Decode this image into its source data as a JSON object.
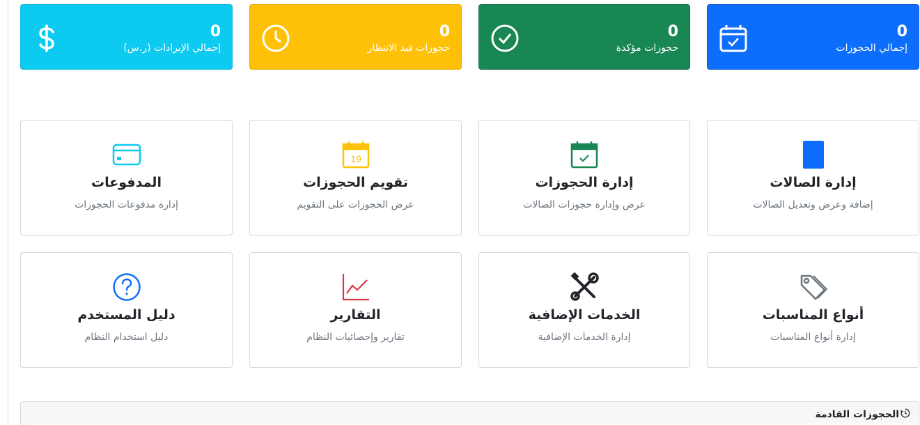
{
  "stats": [
    {
      "key": "total",
      "value": "0",
      "label": "إجمالي الحجوزات",
      "icon": "calendar-check-icon",
      "color": "#0d6efd"
    },
    {
      "key": "confirmed",
      "value": "0",
      "label": "حجوزات مؤكدة",
      "icon": "check-circle-icon",
      "color": "#198754"
    },
    {
      "key": "pending",
      "value": "0",
      "label": "حجوزات قيد الانتظار",
      "icon": "clock-icon",
      "color": "#ffc107"
    },
    {
      "key": "revenue",
      "value": "0",
      "label": "إجمالي الإيرادات (ر.س)",
      "icon": "dollar-icon",
      "color": "#0dcaf0"
    }
  ],
  "features": [
    {
      "key": "halls",
      "title": "إدارة الصالات",
      "description": "إضافة وعرض وتعديل الصالات",
      "icon": "door-icon",
      "color": "#0d6efd"
    },
    {
      "key": "bookings",
      "title": "إدارة الحجوزات",
      "description": "عرض وإدارة حجوزات الصالات",
      "icon": "calendar-check-icon",
      "color": "#198754"
    },
    {
      "key": "calendar",
      "title": "تقويم الحجوزات",
      "description": "عرض الحجوزات على التقويم",
      "icon": "calendar-date-icon",
      "icon_text": "19",
      "color": "#ffc107"
    },
    {
      "key": "payments",
      "title": "المدفوعات",
      "description": "إدارة مدفوعات الحجوزات",
      "icon": "credit-card-icon",
      "color": "#0dcaf0"
    },
    {
      "key": "occasions",
      "title": "أنواع المناسبات",
      "description": "إدارة أنواع المناسبات",
      "icon": "tag-icon",
      "color": "#6c757d"
    },
    {
      "key": "services",
      "title": "الخدمات الإضافية",
      "description": "إدارة الخدمات الإضافية",
      "icon": "tools-icon",
      "color": "#212529"
    },
    {
      "key": "reports",
      "title": "التقارير",
      "description": "تقارير وإحصائيات النظام",
      "icon": "line-chart-icon",
      "color": "#dc3545"
    },
    {
      "key": "guide",
      "title": "دليل المستخدم",
      "description": "دليل استخدام النظام",
      "icon": "question-circle-icon",
      "color": "#0d6efd"
    }
  ],
  "upcoming": {
    "title": "الحجوزات القادمة",
    "icon": "clock-history-icon"
  }
}
